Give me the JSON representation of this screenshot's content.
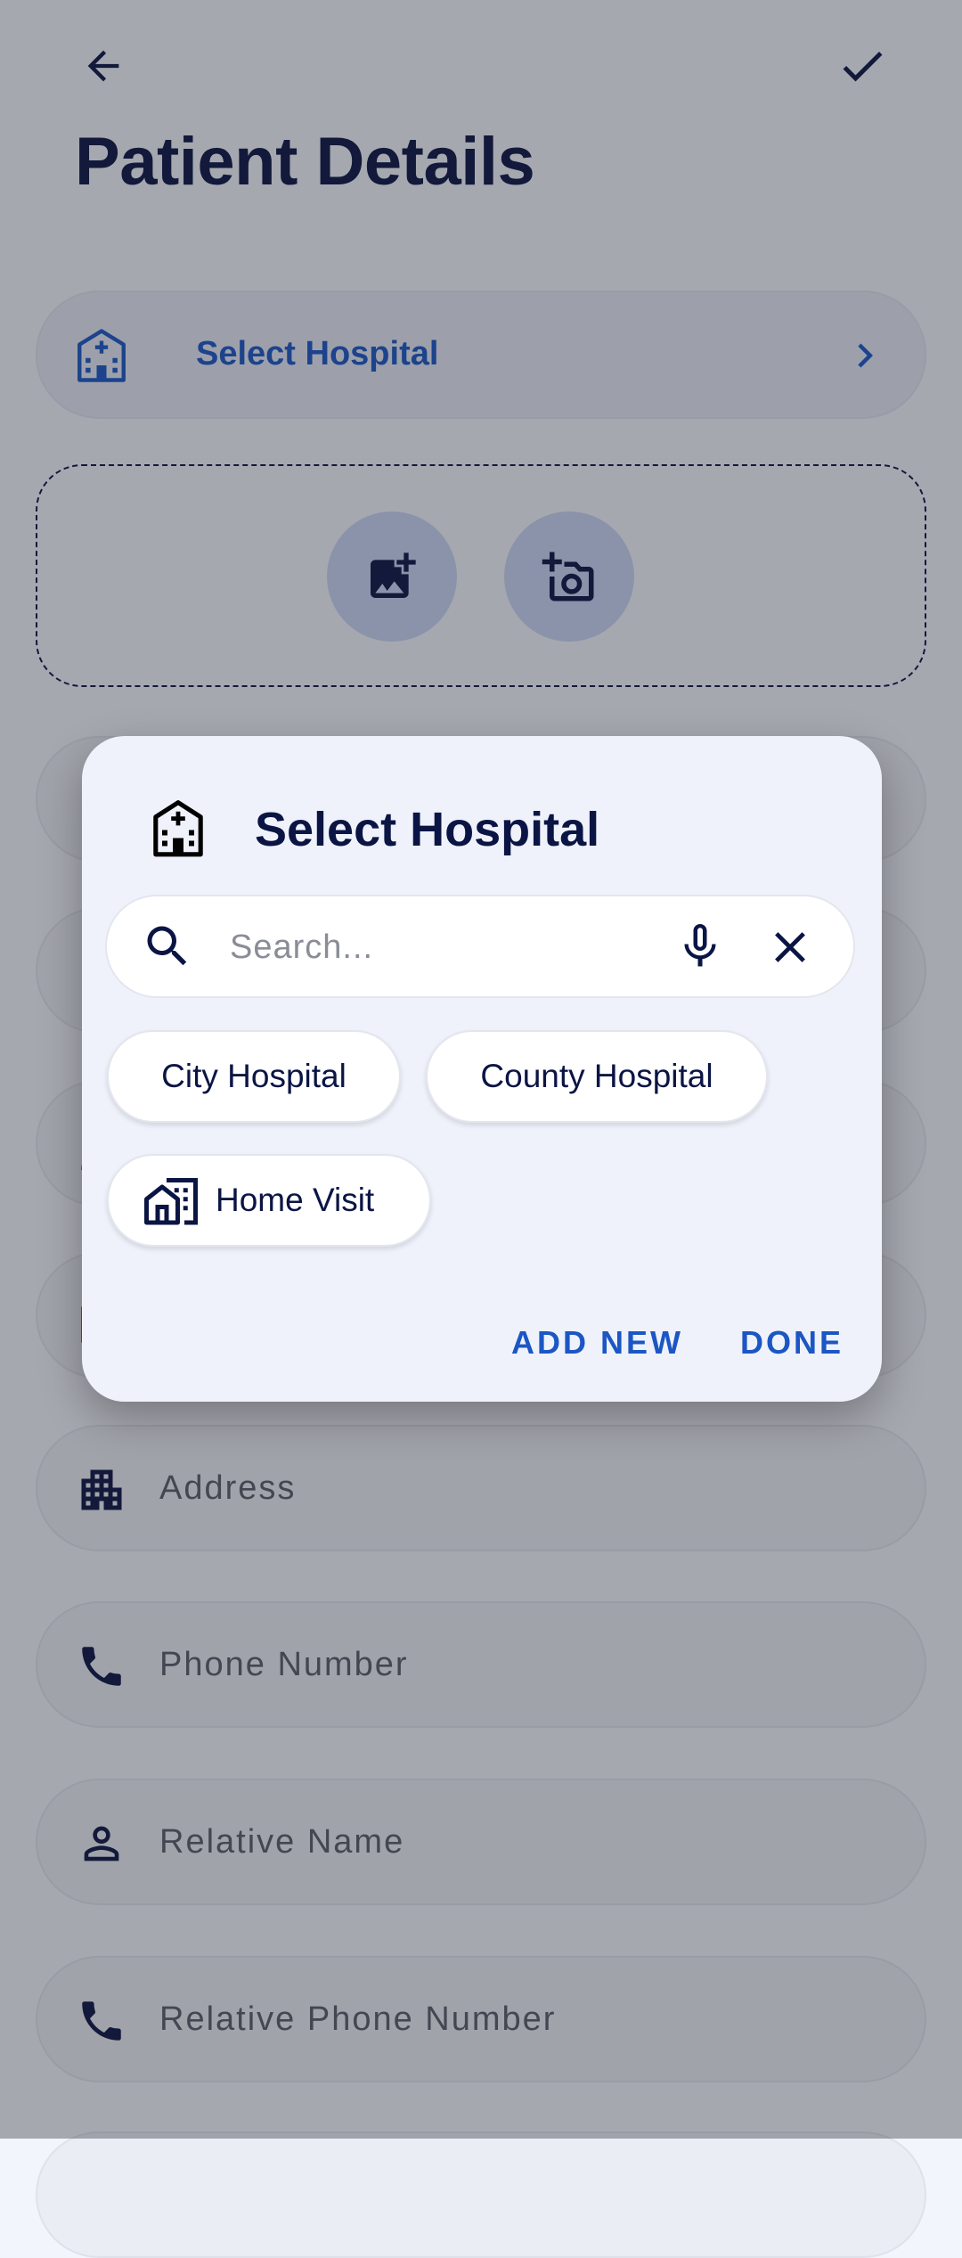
{
  "header": {
    "back_icon": "arrow-back-icon",
    "confirm_icon": "check-icon",
    "title": "Patient Details"
  },
  "form": {
    "hospital_label": "Select Hospital",
    "address_label": "Address",
    "phone_label": "Phone Number",
    "relative_name_label": "Relative Name",
    "relative_phone_label": "Relative Phone Number"
  },
  "dialog": {
    "icon": "hospital-icon",
    "title": "Select Hospital",
    "search_placeholder": "Search...",
    "search_value": "",
    "chips": [
      {
        "label": "City Hospital"
      },
      {
        "label": "County Hospital"
      },
      {
        "label": "Home Visit",
        "icon": "home-work-icon"
      }
    ],
    "add_new_label": "ADD NEW",
    "done_label": "DONE"
  },
  "colors": {
    "primary": "#1b56c4",
    "title_text": "#0b1544",
    "dialog_bg": "#eff2fb",
    "photo_button_bg": "#c9d4f2"
  }
}
